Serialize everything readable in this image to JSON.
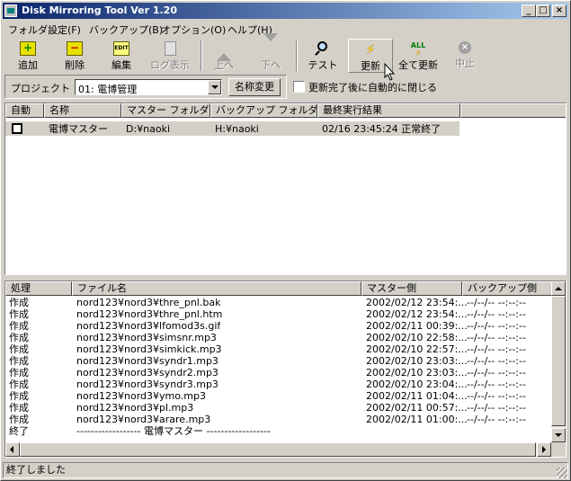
{
  "window": {
    "title": "Disk Mirroring Tool Ver 1.20"
  },
  "menu": [
    {
      "label": "フォルダ設定(F)"
    },
    {
      "label": "バックアップ(B)"
    },
    {
      "label": "オプション(O)"
    },
    {
      "label": "ヘルプ(H)"
    }
  ],
  "toolbar": {
    "add": "追加",
    "delete": "削除",
    "edit": "編集",
    "edit_icon_text": "EDIT",
    "log": "ログ表示",
    "up": "上へ",
    "down": "下へ",
    "test": "テスト",
    "update": "更新",
    "update_all": "全て更新",
    "update_all_icon_text": "ALL",
    "stop": "中止"
  },
  "project": {
    "label": "プロジェクト",
    "selected": "01: 電博管理",
    "rename_button": "名称変更",
    "auto_close_label": "更新完了後に自動的に閉じる",
    "auto_close_checked": false
  },
  "folders": {
    "columns": [
      "自動",
      "名称",
      "マスター フォルダ",
      "バックアップ フォルダ",
      "最終実行結果"
    ],
    "rows": [
      {
        "auto": false,
        "name": "電博マスター",
        "master": "D:¥naoki",
        "backup": "H:¥naoki",
        "last_result": "02/16 23:45:24 正常終了"
      }
    ]
  },
  "log": {
    "columns": [
      "処理",
      "ファイル名",
      "マスター側",
      "バックアップ側"
    ],
    "rows": [
      {
        "action": "作成",
        "file": "nord123¥nord3¥thre_pnl.bak",
        "master": "2002/02/12 23:54:...",
        "backup": "--/--/-- --:--:--"
      },
      {
        "action": "作成",
        "file": "nord123¥nord3¥thre_pnl.htm",
        "master": "2002/02/12 23:54:...",
        "backup": "--/--/-- --:--:--"
      },
      {
        "action": "作成",
        "file": "nord123¥nord3¥lfomod3s.gif",
        "master": "2002/02/11 00:39:...",
        "backup": "--/--/-- --:--:--"
      },
      {
        "action": "作成",
        "file": "nord123¥nord3¥simsnr.mp3",
        "master": "2002/02/10 22:58:...",
        "backup": "--/--/-- --:--:--"
      },
      {
        "action": "作成",
        "file": "nord123¥nord3¥simkick.mp3",
        "master": "2002/02/10 22:57:...",
        "backup": "--/--/-- --:--:--"
      },
      {
        "action": "作成",
        "file": "nord123¥nord3¥syndr1.mp3",
        "master": "2002/02/10 23:03:...",
        "backup": "--/--/-- --:--:--"
      },
      {
        "action": "作成",
        "file": "nord123¥nord3¥syndr2.mp3",
        "master": "2002/02/10 23:03:...",
        "backup": "--/--/-- --:--:--"
      },
      {
        "action": "作成",
        "file": "nord123¥nord3¥syndr3.mp3",
        "master": "2002/02/10 23:04:...",
        "backup": "--/--/-- --:--:--"
      },
      {
        "action": "作成",
        "file": "nord123¥nord3¥ymo.mp3",
        "master": "2002/02/11 01:04:...",
        "backup": "--/--/-- --:--:--"
      },
      {
        "action": "作成",
        "file": "nord123¥nord3¥pl.mp3",
        "master": "2002/02/11 00:57:...",
        "backup": "--/--/-- --:--:--"
      },
      {
        "action": "作成",
        "file": "nord123¥nord3¥arare.mp3",
        "master": "2002/02/11 01:00:...",
        "backup": "--/--/-- --:--:--"
      },
      {
        "action": "終了",
        "file": "------------------ 電博マスター ------------------",
        "master": "",
        "backup": ""
      }
    ]
  },
  "status": {
    "text": "終了しました"
  }
}
